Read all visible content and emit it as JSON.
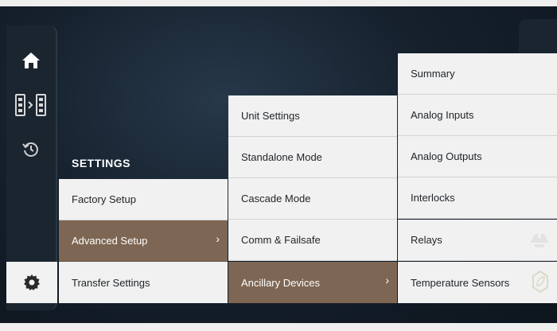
{
  "nav": {
    "items": [
      {
        "name": "home-icon",
        "active": false
      },
      {
        "name": "transfer-switch-icon",
        "active": false
      },
      {
        "name": "history-icon",
        "active": false
      },
      {
        "name": "settings-gear-icon",
        "active": true
      }
    ]
  },
  "settings": {
    "title": "SETTINGS",
    "level1": [
      "Factory Setup",
      "Advanced Setup",
      "Transfer Settings"
    ],
    "level1_selected": "Advanced Setup",
    "level2": [
      "Unit Settings",
      "Standalone Mode",
      "Cascade Mode",
      "Comm & Failsafe",
      "Ancillary Devices"
    ],
    "level2_selected": "Ancillary Devices",
    "level3": [
      "Summary",
      "Analog Inputs",
      "Analog Outputs",
      "Interlocks",
      "Relays",
      "Temperature Sensors"
    ]
  },
  "icons": {
    "chevron": "›",
    "relays_trailing_icon": "hardhat-icon",
    "temperature_trailing_icon": "leaf-icon"
  },
  "colors": {
    "selected_row": "#7d6653",
    "row_bg": "#f1f1f1",
    "background": "#15202c"
  }
}
